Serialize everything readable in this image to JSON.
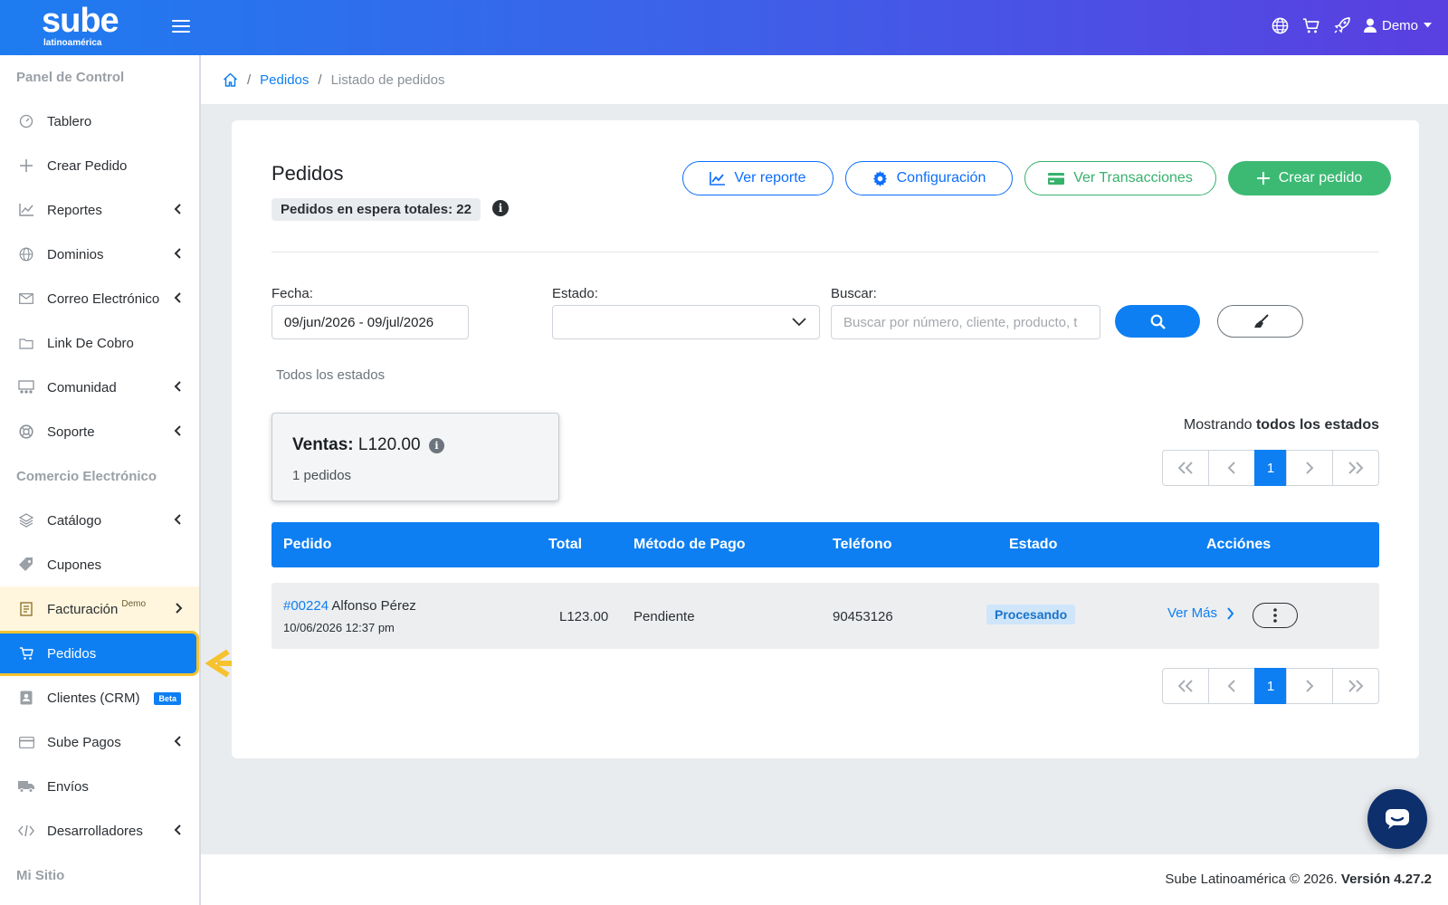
{
  "brand": {
    "logo_word": "sube",
    "logo_sub": "latinoamérica"
  },
  "topbar": {
    "user_name": "Demo",
    "icons": [
      "globe-icon",
      "cart-icon",
      "rocket-icon",
      "user-icon"
    ]
  },
  "sidebar": {
    "sections": [
      "Panel de Control",
      "Comercio Electrónico",
      "Mi Sitio"
    ],
    "items": [
      {
        "label": "Tablero",
        "icon": "gauge-icon"
      },
      {
        "label": "Crear Pedido",
        "icon": "plus-icon"
      },
      {
        "label": "Reportes",
        "icon": "chart-icon"
      },
      {
        "label": "Dominios",
        "icon": "globe-icon"
      },
      {
        "label": "Correo Electrónico",
        "icon": "mail-icon"
      },
      {
        "label": "Link De Cobro",
        "icon": "folder-icon"
      },
      {
        "label": "Comunidad",
        "icon": "community-icon"
      },
      {
        "label": "Soporte",
        "icon": "lifebuoy-icon"
      },
      {
        "label": "Catálogo",
        "icon": "layers-icon"
      },
      {
        "label": "Cupones",
        "icon": "tag-icon"
      },
      {
        "label": "Facturación",
        "sup": "Demo",
        "icon": "invoice-icon"
      },
      {
        "label": "Pedidos",
        "icon": "cart-icon"
      },
      {
        "label": "Clientes (CRM)",
        "badge": "Beta",
        "icon": "contact-icon"
      },
      {
        "label": "Sube Pagos",
        "icon": "card-icon"
      },
      {
        "label": "Envíos",
        "icon": "truck-icon"
      },
      {
        "label": "Desarrolladores",
        "icon": "code-icon"
      }
    ]
  },
  "breadcrumb": {
    "link": "Pedidos",
    "current": "Listado de pedidos"
  },
  "page": {
    "title": "Pedidos",
    "pending_badge": "Pedidos en espera totales: 22",
    "buttons": {
      "report": "Ver reporte",
      "config": "Configuración",
      "transactions": "Ver Transacciones",
      "create": "Crear pedido"
    }
  },
  "filters": {
    "date_label": "Fecha:",
    "date_value": "09/jun/2026 - 09/jul/2026",
    "status_label": "Estado:",
    "status_value": "",
    "search_label": "Buscar:",
    "search_placeholder": "Buscar por número, cliente, producto, t",
    "all_states": "Todos los estados"
  },
  "summary": {
    "sales_label": "Ventas:",
    "sales_value": "L120.00",
    "orders_count": "1 pedidos",
    "showing_prefix": "Mostrando",
    "showing_bold": "todos los estados"
  },
  "pagination": {
    "current": "1"
  },
  "table": {
    "headers": [
      "Pedido",
      "Total",
      "Método de Pago",
      "Teléfono",
      "Estado",
      "Acciónes"
    ],
    "rows": [
      {
        "order_no": "#00224",
        "customer": "Alfonso Pérez",
        "datetime": "10/06/2026 12:37 pm",
        "total": "L123.00",
        "payment": "Pendiente",
        "phone": "90453126",
        "status": "Procesando",
        "action": "Ver Más"
      }
    ]
  },
  "footer": {
    "copyright": "Sube Latinoamérica © 2026.",
    "version": "Versión 4.27.2"
  },
  "colors": {
    "primary": "#0d7ff2",
    "success": "#3cba74",
    "highlight": "#f6c22e"
  }
}
